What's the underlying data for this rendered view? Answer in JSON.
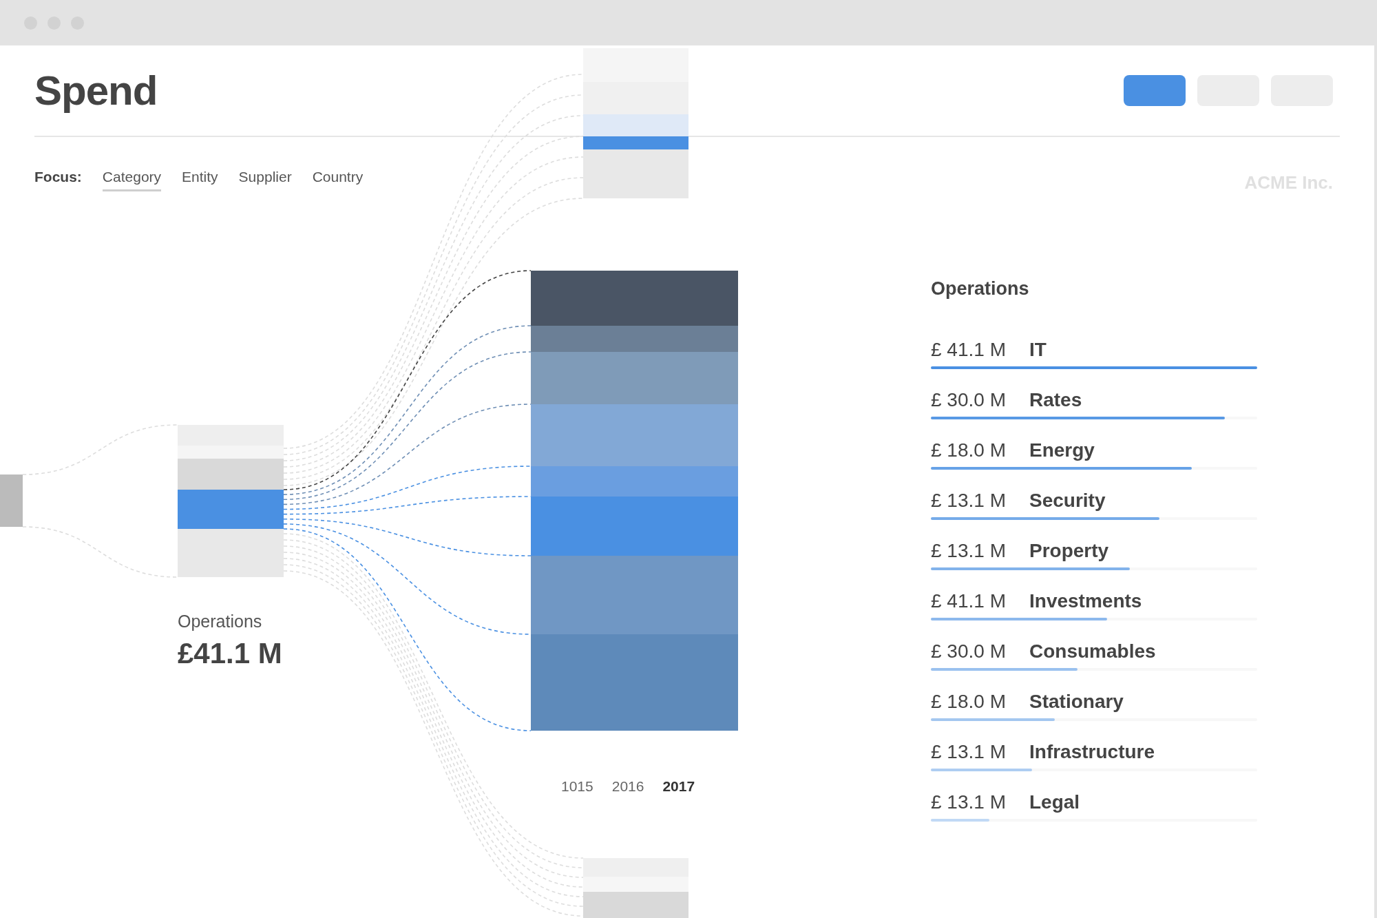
{
  "header": {
    "title": "Spend",
    "buttons": [
      {
        "selected": true
      },
      {
        "selected": false
      },
      {
        "selected": false
      }
    ]
  },
  "focus": {
    "label": "Focus:",
    "tabs": [
      {
        "label": "Category",
        "selected": true
      },
      {
        "label": "Entity",
        "selected": false
      },
      {
        "label": "Supplier",
        "selected": false
      },
      {
        "label": "Country",
        "selected": false
      }
    ]
  },
  "brand": "ACME Inc.",
  "flow": {
    "label": "Operations",
    "amount": "£41.1 M",
    "years": [
      {
        "label": "1015",
        "selected": false
      },
      {
        "label": "2016",
        "selected": false
      },
      {
        "label": "2017",
        "selected": true
      }
    ]
  },
  "breakdown": {
    "title": "Operations",
    "rows": [
      {
        "amount": "£ 41.1 M",
        "name": "IT",
        "level": 1.0
      },
      {
        "amount": "£ 30.0 M",
        "name": "Rates",
        "level": 0.9
      },
      {
        "amount": "£ 18.0 M",
        "name": "Energy",
        "level": 0.8
      },
      {
        "amount": "£ 13.1 M",
        "name": "Security",
        "level": 0.7
      },
      {
        "amount": "£ 13.1 M",
        "name": "Property",
        "level": 0.61
      },
      {
        "amount": "£ 41.1 M",
        "name": "Investments",
        "level": 0.54
      },
      {
        "amount": "£ 30.0 M",
        "name": "Consumables",
        "level": 0.45
      },
      {
        "amount": "£ 18.0 M",
        "name": "Stationary",
        "level": 0.38
      },
      {
        "amount": "£ 13.1 M",
        "name": "Infrastructure",
        "level": 0.31
      },
      {
        "amount": "£ 13.1 M",
        "name": "Legal",
        "level": 0.18
      }
    ]
  }
}
